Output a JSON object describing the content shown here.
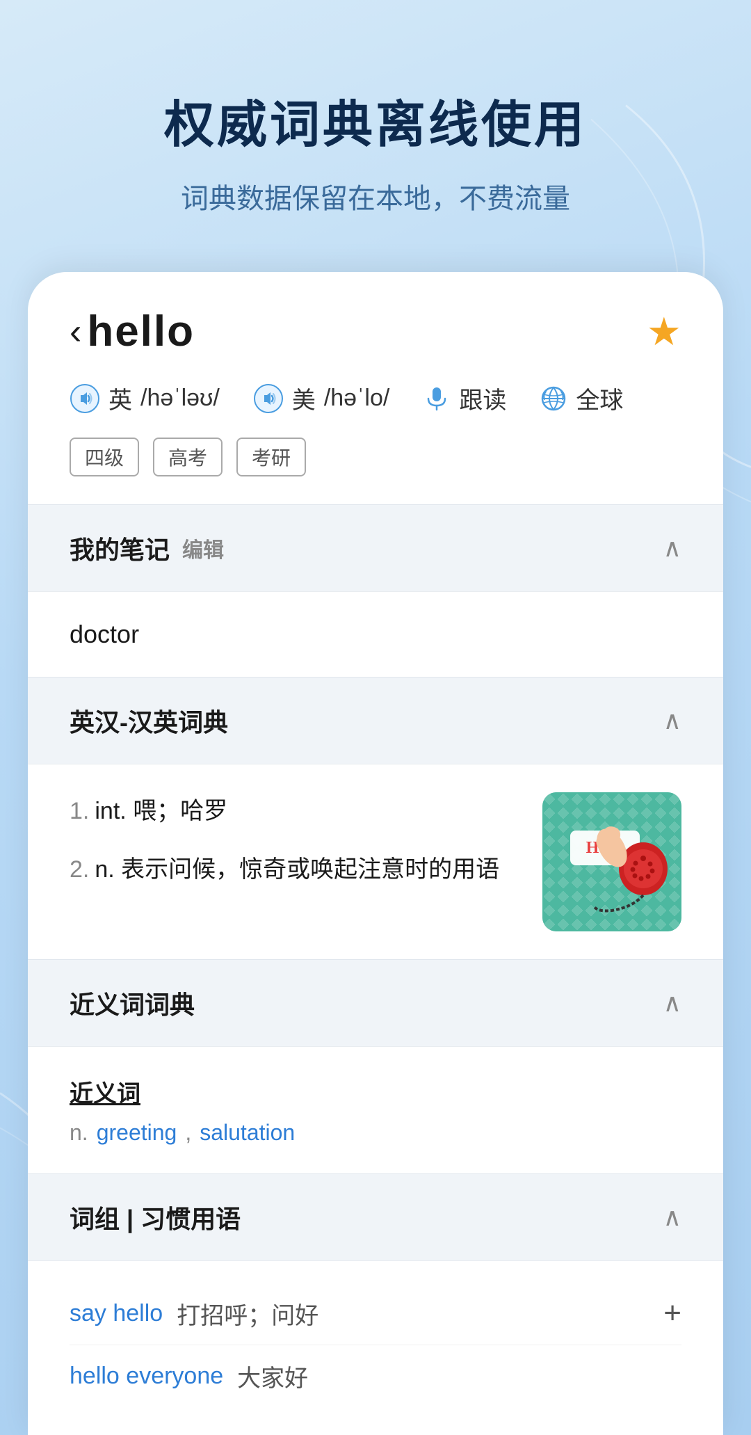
{
  "page": {
    "background_title": "权威词典离线使用",
    "background_subtitle": "词典数据保留在本地，不费流量"
  },
  "word_header": {
    "back_arrow": "‹",
    "word": "hello",
    "star_filled": true
  },
  "pronunciation": {
    "british_label": "英",
    "british_phonetic": "/həˈləʊ/",
    "american_label": "美",
    "american_phonetic": "/həˈlo/",
    "follow_read_label": "跟读",
    "global_label": "全球"
  },
  "tags": [
    "四级",
    "高考",
    "考研"
  ],
  "notes_section": {
    "title": "我的笔记",
    "edit_label": "编辑",
    "content": "doctor",
    "collapsed": false
  },
  "dictionary_section": {
    "title": "英汉-汉英词典",
    "collapsed": false,
    "definitions": [
      {
        "number": "1.",
        "part": "int.",
        "meaning": "喂；哈罗"
      },
      {
        "number": "2.",
        "part": "n.",
        "meaning": "表示问候，惊奇或唤起注意时的用语"
      }
    ]
  },
  "synonyms_section": {
    "title": "近义词词典",
    "collapsed": false,
    "synonyms_label": "近义词",
    "part_of_speech": "n.",
    "words": [
      "greeting",
      "salutation"
    ]
  },
  "phrases_section": {
    "title": "词组 | 习惯用语",
    "collapsed": false,
    "phrases": [
      {
        "phrase": "say hello",
        "meaning": "打招呼；问好"
      },
      {
        "phrase": "hello everyone",
        "meaning": "大家好"
      }
    ]
  }
}
